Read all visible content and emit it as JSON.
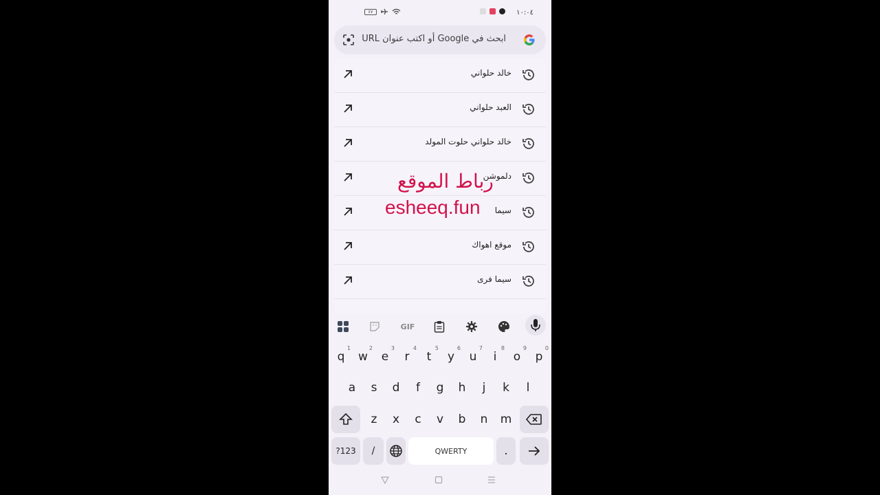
{
  "status_bar": {
    "time": "١٠:٠٤",
    "battery": "٤٧"
  },
  "omnibox": {
    "placeholder": "ابحث في Google أو اكتب عنوان URL"
  },
  "suggestions": [
    {
      "label": "خالد حلواني"
    },
    {
      "label": "العبد حلواني"
    },
    {
      "label": "خالد حلواني حلوت المولد"
    },
    {
      "label": "دلموشن"
    },
    {
      "label": "سيما"
    },
    {
      "label": "موقع اهواك"
    },
    {
      "label": "سيما فرى"
    }
  ],
  "watermark": {
    "line1": "رباط الموقع",
    "line2": "esheeq.fun"
  },
  "keyboard_toolbar": {
    "gif_label": "GIF"
  },
  "keyboard": {
    "row1": [
      {
        "key": "q",
        "hint": "1"
      },
      {
        "key": "w",
        "hint": "2"
      },
      {
        "key": "e",
        "hint": "3"
      },
      {
        "key": "r",
        "hint": "4"
      },
      {
        "key": "t",
        "hint": "5"
      },
      {
        "key": "y",
        "hint": "6"
      },
      {
        "key": "u",
        "hint": "7"
      },
      {
        "key": "i",
        "hint": "8"
      },
      {
        "key": "o",
        "hint": "9"
      },
      {
        "key": "p",
        "hint": "0"
      }
    ],
    "row2": [
      "a",
      "s",
      "d",
      "f",
      "g",
      "h",
      "j",
      "k",
      "l"
    ],
    "row3": [
      "z",
      "x",
      "c",
      "v",
      "b",
      "n",
      "m"
    ],
    "symbols_label": "?123",
    "slash_label": "/",
    "space_label": "QWERTY",
    "period_label": "."
  },
  "colors": {
    "accent": "#d1134a",
    "background": "#f4f1f8"
  }
}
